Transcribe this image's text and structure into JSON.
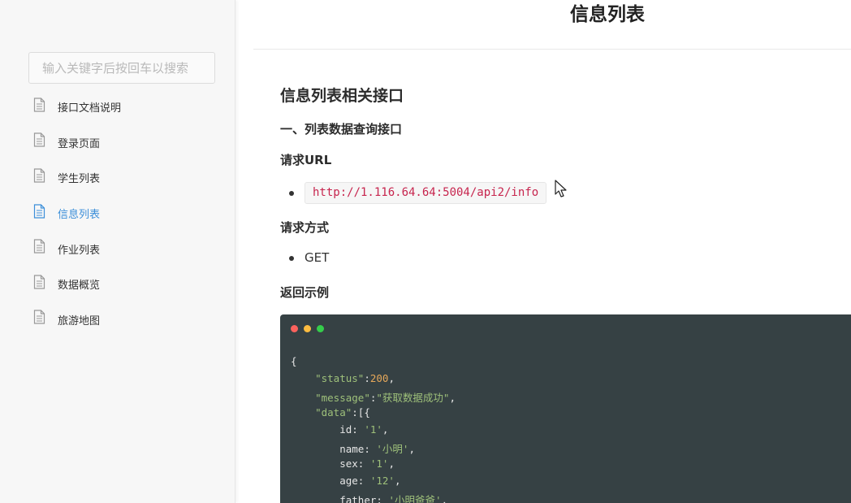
{
  "sidebar": {
    "search_placeholder": "输入关键字后按回车以搜索",
    "items": [
      {
        "label": "接口文档说明",
        "active": false
      },
      {
        "label": "登录页面",
        "active": false
      },
      {
        "label": "学生列表",
        "active": false
      },
      {
        "label": "信息列表",
        "active": true
      },
      {
        "label": "作业列表",
        "active": false
      },
      {
        "label": "数据概览",
        "active": false
      },
      {
        "label": "旅游地图",
        "active": false
      }
    ]
  },
  "page": {
    "title": "信息列表",
    "section_title": "信息列表相关接口",
    "subsection_title": "一、列表数据查询接口",
    "url_heading": "请求URL",
    "url": "http://1.116.64.64:5004/api2/info",
    "method_heading": "请求方式",
    "method": "GET",
    "example_heading": "返回示例"
  },
  "code": {
    "l1": "{",
    "l2_key": "\"status\"",
    "l2_colon": ":",
    "l2_val": "200",
    "l2_end": ",",
    "l3_key": "\"message\"",
    "l3_colon": ":",
    "l3_val": "\"获取数据成功\"",
    "l3_end": ",",
    "l4_key": "\"data\"",
    "l4_rest": ":[{",
    "l5_key": "id: ",
    "l5_val": "'1'",
    "l5_end": ",",
    "l6_key": "name: ",
    "l6_val": "'小明'",
    "l6_end": ",",
    "l7_key": "sex: ",
    "l7_val": "'1'",
    "l7_end": ",",
    "l8_key": "age: ",
    "l8_val": "'12'",
    "l8_end": ",",
    "l9_key": "father: ",
    "l9_val": "'小明爸爸'",
    "l9_end": ","
  },
  "colors": {
    "accent": "#3c8fd9",
    "code_bg": "#364144",
    "inline_code": "#c7254e"
  }
}
